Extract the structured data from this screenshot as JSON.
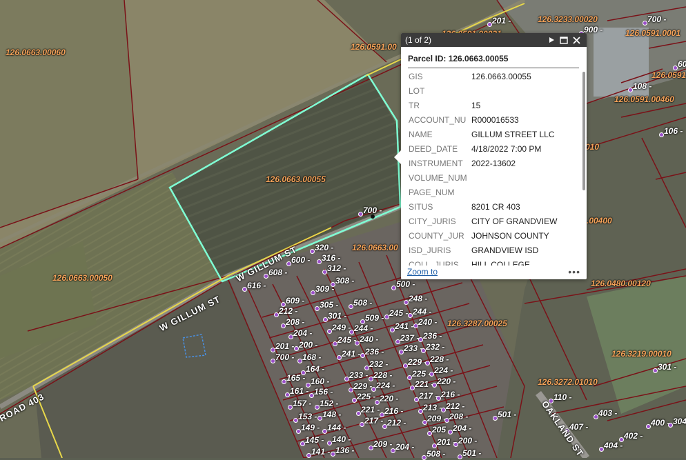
{
  "map": {
    "parcel_labels": [
      {
        "text": "126.0663.00060"
      },
      {
        "text": "126.0591.00"
      },
      {
        "text": "126.0663.00055"
      },
      {
        "text": "126.0663.00050"
      },
      {
        "text": "126.0663.00"
      },
      {
        "text": "126.3287.00025"
      },
      {
        "text": "126.3233.00020"
      },
      {
        "text": "126.0591.00021"
      },
      {
        "text": "126.0591.0001"
      },
      {
        "text": "126.0591"
      },
      {
        "text": "126.0591.00460"
      },
      {
        "text": "010"
      },
      {
        "text": ".00400"
      },
      {
        "text": "126.0480.00120"
      },
      {
        "text": "126.3219.00010"
      },
      {
        "text": "126.3272.01010"
      }
    ],
    "lot_numbers": [
      "201 -",
      "700 -",
      "900 -",
      "108 -",
      "106 -",
      "60",
      "700 -",
      "320 -",
      "316 -",
      "600 -",
      "312 -",
      "608 -",
      "308 -",
      "616 -",
      "309 -",
      "500 -",
      "609 -",
      "305 -",
      "508 -",
      "248 -",
      "212 -",
      "301 -",
      "509 -",
      "245 -",
      "244 -",
      "208 -",
      "249 -",
      "244 -",
      "241 -",
      "240 -",
      "204 -",
      "245 -",
      "240 -",
      "237 -",
      "236 -",
      "201 -",
      "200 -",
      "241 -",
      "236 -",
      "233 -",
      "232 -",
      "700 -",
      "168 -",
      "232 -",
      "229 -",
      "228 -",
      "164 -",
      "233 -",
      "228 -",
      "225 -",
      "224 -",
      "165 -",
      "160 -",
      "229 -",
      "224 -",
      "221 -",
      "220 -",
      "161 -",
      "156 -",
      "225 -",
      "220 -",
      "217 -",
      "216 -",
      "157 -",
      "152 -",
      "221 -",
      "216 -",
      "213 -",
      "212 -",
      "153 -",
      "148 -",
      "217 -",
      "212 -",
      "209 -",
      "208 -",
      "149 -",
      "144 -",
      "205 -",
      "204 -",
      "145 -",
      "140 -",
      "209 -",
      "201 -",
      "200 -",
      "141 -",
      "136 -",
      "204 -",
      "508 -",
      "501 -",
      "110 -",
      "501 -",
      "407 -",
      "403 -",
      "400 -",
      "304",
      "402 -",
      "404 -",
      "301 -"
    ],
    "streets": [
      {
        "text": "W GILLUM ST"
      },
      {
        "text": "W GILLUM ST"
      },
      {
        "text": "ROAD 403"
      },
      {
        "text": "OAKLAND ST"
      }
    ]
  },
  "popup": {
    "count": "(1 of 2)",
    "title": "Parcel ID: 126.0663.00055",
    "attributes": [
      {
        "key": "GIS",
        "value": "126.0663.00055"
      },
      {
        "key": "LOT",
        "value": ""
      },
      {
        "key": "TR",
        "value": "15"
      },
      {
        "key": "ACCOUNT_NU",
        "value": "R000016533"
      },
      {
        "key": "NAME",
        "value": "GILLUM STREET LLC"
      },
      {
        "key": "DEED_DATE",
        "value": "4/18/2022 7:00 PM"
      },
      {
        "key": "INSTRUMENT",
        "value": "2022-13602"
      },
      {
        "key": "VOLUME_NUM",
        "value": ""
      },
      {
        "key": "PAGE_NUM",
        "value": ""
      },
      {
        "key": "SITUS",
        "value": "8201 CR 403"
      },
      {
        "key": "CITY_JURIS",
        "value": "CITY OF GRANDVIEW"
      },
      {
        "key": "COUNTY_JUR",
        "value": "JOHNSON COUNTY"
      },
      {
        "key": "ISD_JURIS",
        "value": "GRANDVIEW ISD"
      },
      {
        "key": "COLL_JURIS",
        "value": "HILL COLLEGE"
      }
    ],
    "zoom_label": "Zoom to",
    "more_label": "•••",
    "next_icon": "play-icon",
    "maximize_icon": "maximize-icon",
    "close_icon": "close-icon"
  }
}
